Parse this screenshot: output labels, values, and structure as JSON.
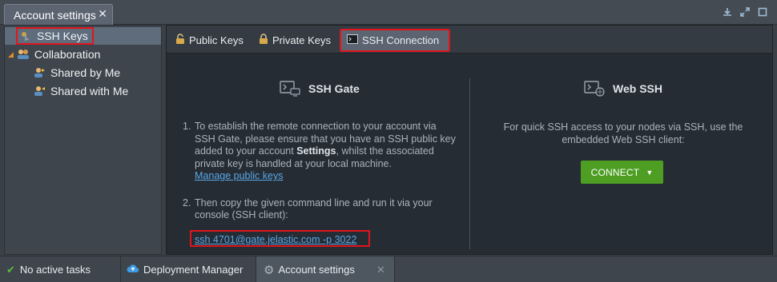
{
  "window": {
    "tab_title": "Account settings",
    "close_glyph": "✕",
    "controls": [
      "download-icon",
      "expand-icon",
      "maximize-icon"
    ]
  },
  "tree": {
    "items": [
      {
        "label": "SSH Keys",
        "icon": "keys-icon",
        "selected": true
      },
      {
        "label": "Collaboration",
        "icon": "collaboration-icon",
        "expanded": true
      },
      {
        "label": "Shared by Me",
        "icon": "user-share-icon"
      },
      {
        "label": "Shared with Me",
        "icon": "user-shared-icon"
      }
    ]
  },
  "tabs": [
    {
      "label": "Public Keys",
      "icon": "open-lock-icon"
    },
    {
      "label": "Private Keys",
      "icon": "lock-icon"
    },
    {
      "label": "SSH Connection",
      "icon": "terminal-icon",
      "active": true
    }
  ],
  "ssh_gate": {
    "title": "SSH Gate",
    "step1_num": "1.",
    "step1_text_a": "To establish the remote connection to your account via SSH Gate, please ensure that you have an SSH public key added to your account ",
    "step1_bold": "Settings",
    "step1_text_b": ", whilst the associated private key is handled at your local machine.",
    "manage_link": "Manage public keys",
    "step2_num": "2.",
    "step2_text": "Then copy the given command line and run it via your console (SSH client):",
    "command": "ssh 4701@gate.jelastic.com -p 3022"
  },
  "web_ssh": {
    "title": "Web SSH",
    "description": "For quick SSH access to your nodes via SSH, use the embedded Web SSH client:",
    "connect_label": "CONNECT"
  },
  "statusbar": {
    "tasks": "No active tasks",
    "deployment_manager": "Deployment Manager",
    "account_settings": "Account settings",
    "close_glyph": "✕"
  },
  "colors": {
    "accent_green": "#4e9e24",
    "link_blue": "#58a8e8",
    "highlight_red": "#e0151c"
  }
}
